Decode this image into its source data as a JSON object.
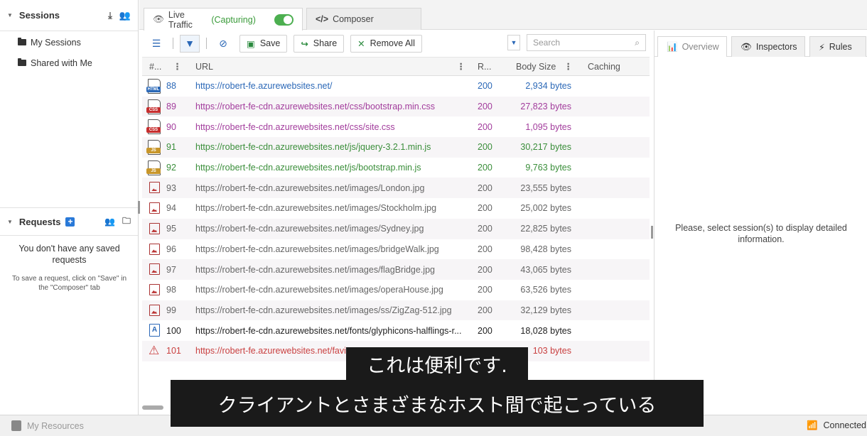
{
  "sidebar": {
    "sessions_title": "Sessions",
    "items": [
      {
        "label": "My Sessions"
      },
      {
        "label": "Shared with Me"
      }
    ],
    "requests_title": "Requests",
    "empty_title": "You don't have any saved requests",
    "empty_hint": "To save a request, click on \"Save\" in the \"Composer\" tab"
  },
  "tabs": {
    "live_label": "Live Traffic",
    "capturing": "(Capturing)",
    "composer_label": "Composer"
  },
  "toolbar": {
    "save_label": "Save",
    "share_label": "Share",
    "remove_label": "Remove All",
    "search_placeholder": "Search"
  },
  "grid": {
    "columns": [
      "#...",
      "URL",
      "R...",
      "Body Size",
      "Caching"
    ],
    "rows": [
      {
        "icon": "html-file-icon",
        "num": "88",
        "url": "https://robert-fe.azurewebsites.net/",
        "result": "200",
        "size": "2,934 bytes",
        "color": "blue"
      },
      {
        "icon": "css-file-icon",
        "num": "89",
        "url": "https://robert-fe-cdn.azurewebsites.net/css/bootstrap.min.css",
        "result": "200",
        "size": "27,823 bytes",
        "color": "purple"
      },
      {
        "icon": "css-file-icon",
        "num": "90",
        "url": "https://robert-fe-cdn.azurewebsites.net/css/site.css",
        "result": "200",
        "size": "1,095 bytes",
        "color": "purple"
      },
      {
        "icon": "js-file-icon",
        "num": "91",
        "url": "https://robert-fe-cdn.azurewebsites.net/js/jquery-3.2.1.min.js",
        "result": "200",
        "size": "30,217 bytes",
        "color": "green"
      },
      {
        "icon": "js-file-icon",
        "num": "92",
        "url": "https://robert-fe-cdn.azurewebsites.net/js/bootstrap.min.js",
        "result": "200",
        "size": "9,763 bytes",
        "color": "green"
      },
      {
        "icon": "image-file-icon",
        "num": "93",
        "url": "https://robert-fe-cdn.azurewebsites.net/images/London.jpg",
        "result": "200",
        "size": "23,555 bytes",
        "color": "gray"
      },
      {
        "icon": "image-file-icon",
        "num": "94",
        "url": "https://robert-fe-cdn.azurewebsites.net/images/Stockholm.jpg",
        "result": "200",
        "size": "25,002 bytes",
        "color": "gray"
      },
      {
        "icon": "image-file-icon",
        "num": "95",
        "url": "https://robert-fe-cdn.azurewebsites.net/images/Sydney.jpg",
        "result": "200",
        "size": "22,825 bytes",
        "color": "gray"
      },
      {
        "icon": "image-file-icon",
        "num": "96",
        "url": "https://robert-fe-cdn.azurewebsites.net/images/bridgeWalk.jpg",
        "result": "200",
        "size": "98,428 bytes",
        "color": "gray"
      },
      {
        "icon": "image-file-icon",
        "num": "97",
        "url": "https://robert-fe-cdn.azurewebsites.net/images/flagBridge.jpg",
        "result": "200",
        "size": "43,065 bytes",
        "color": "gray"
      },
      {
        "icon": "image-file-icon",
        "num": "98",
        "url": "https://robert-fe-cdn.azurewebsites.net/images/operaHouse.jpg",
        "result": "200",
        "size": "63,526 bytes",
        "color": "gray"
      },
      {
        "icon": "image-file-icon",
        "num": "99",
        "url": "https://robert-fe-cdn.azurewebsites.net/images/ss/ZigZag-512.jpg",
        "result": "200",
        "size": "32,129 bytes",
        "color": "gray"
      },
      {
        "icon": "font-file-icon",
        "num": "100",
        "url": "https://robert-fe-cdn.azurewebsites.net/fonts/glyphicons-halflings-r...",
        "result": "200",
        "size": "18,028 bytes",
        "color": "black"
      },
      {
        "icon": "warning-icon",
        "num": "101",
        "url": "https://robert-fe.azurewebsites.net/favi",
        "result": "",
        "size": "103 bytes",
        "color": "red"
      }
    ]
  },
  "right": {
    "tabs": [
      "Overview",
      "Inspectors",
      "Rules"
    ],
    "message": "Please, select session(s) to display detailed information."
  },
  "status": {
    "resources": "My Resources",
    "connection": "Connected"
  },
  "subtitles": {
    "line1": "これは便利です.",
    "line2": "クライアントとさまざまなホスト間で起こっている"
  }
}
